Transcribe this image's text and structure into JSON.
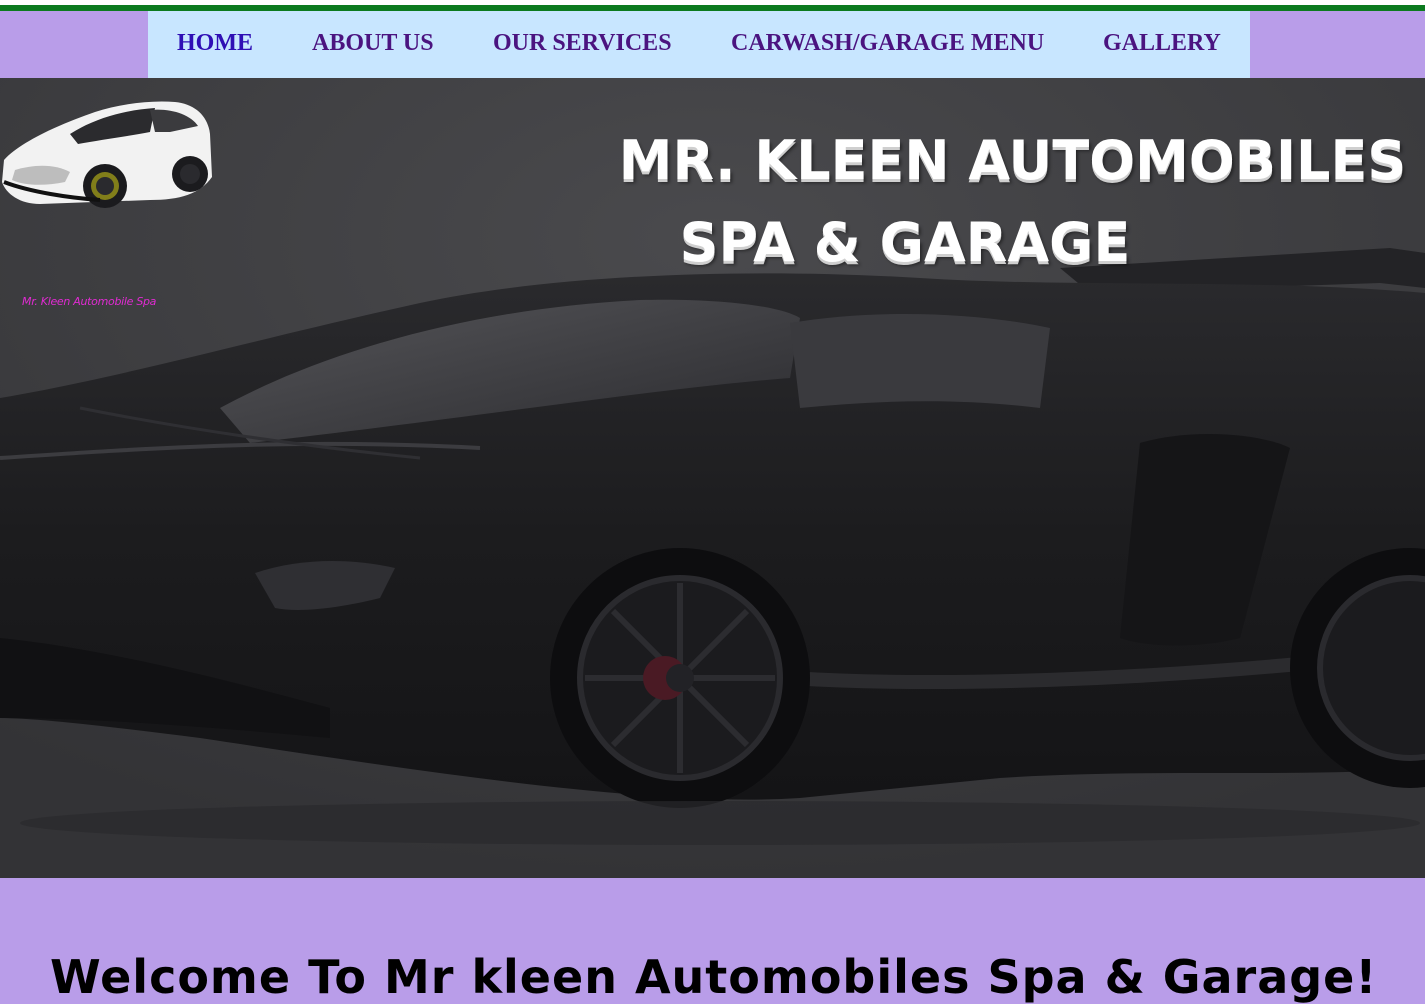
{
  "nav": {
    "items": [
      {
        "label": "HOME",
        "active": true
      },
      {
        "label": "ABOUT US",
        "active": false
      },
      {
        "label": "OUR SERVICES",
        "active": false
      },
      {
        "label": "CARWASH/GARAGE MENU",
        "active": false
      },
      {
        "label": "GALLERY",
        "active": false
      }
    ]
  },
  "logo": {
    "caption": "Mr. Kleen Automobile Spa"
  },
  "hero": {
    "title_line1": "MR. KLEEN AUTOMOBILES",
    "title_line2": "SPA & GARAGE"
  },
  "welcome": {
    "heading": "Welcome To Mr kleen Automobiles Spa & Garage!"
  },
  "colors": {
    "nav_bg": "#c8e6ff",
    "band_bg": "#b99de9",
    "nav_text": "#4b1480",
    "nav_active": "#2f0fb5",
    "top_stripe": "#0c7a1f",
    "hero_bg": "#3f3f42"
  }
}
